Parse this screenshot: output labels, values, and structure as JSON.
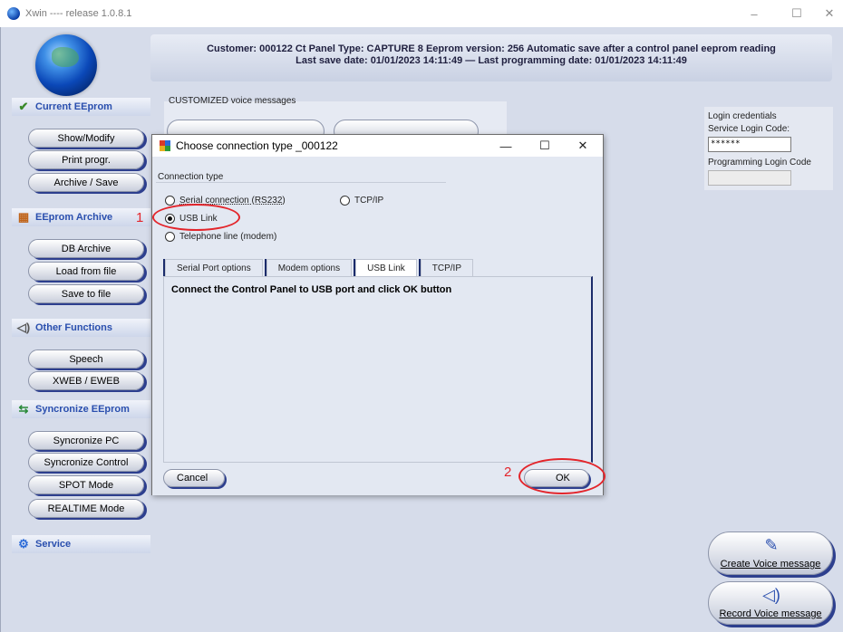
{
  "window": {
    "title": "Xwin ---- release 1.0.8.1",
    "minimize": "–",
    "maximize": "☐",
    "close": "✕"
  },
  "header": {
    "line1": "Customer: 000122 Ct Panel Type: CAPTURE 8 Eeprom version: 256  Automatic save after a control panel eeprom reading",
    "line2": "Last save date: 01/01/2023 14:11:49  —  Last programming date: 01/01/2023 14:11:49"
  },
  "sidebar": {
    "sections": [
      {
        "label": "Current EEprom",
        "icon": "check-icon",
        "glyph": "✔"
      },
      {
        "label": "EEprom Archive",
        "icon": "archive-icon",
        "glyph": "▦"
      },
      {
        "label": "Other Functions",
        "icon": "speaker-icon",
        "glyph": "🔈"
      },
      {
        "label": "Syncronize EEprom",
        "icon": "usb-icon",
        "glyph": "⇆"
      },
      {
        "label": "Service",
        "icon": "gears-icon",
        "glyph": "⚙"
      }
    ],
    "buttons": {
      "show_modify": "Show/Modify",
      "print_progr": "Print progr.",
      "archive_save": "Archive / Save",
      "db_archive": "DB Archive",
      "load_from_file": "Load from file",
      "save_to_file": "Save to file",
      "speech": "Speech",
      "xweb_eweb": "XWEB / EWEB",
      "syncronize_pc": "Syncronize PC",
      "syncronize_control": "Syncronize Control",
      "spot_mode": "SPOT Mode",
      "realtime_mode": "REALTIME Mode"
    }
  },
  "customized": {
    "label": "CUSTOMIZED voice messages"
  },
  "login": {
    "title": "Login credentials",
    "service_label": "Service Login Code:",
    "service_value": "******",
    "programming_label": "Programming Login Code",
    "programming_value": ""
  },
  "right_buttons": {
    "create_voice": "Create Voice message",
    "record_voice": "Record Voice message"
  },
  "dialog": {
    "title": "Choose connection type  _000122",
    "minimize": "—",
    "maximize": "☐",
    "close": "✕",
    "group_label": "Connection type",
    "options": {
      "serial": "Serial connection (RS232)",
      "tcpip": "TCP/IP",
      "usb": "USB Link",
      "telephone": "Telephone line (modem)"
    },
    "selected": "usb",
    "tabs": [
      "Serial Port options",
      "Modem options",
      "USB Link",
      "TCP/IP"
    ],
    "active_tab": 2,
    "message": "Connect the Control Panel to USB port and click OK button",
    "cancel": "Cancel",
    "ok": "OK"
  },
  "annotations": {
    "step1": "1",
    "step2": "2",
    "color": "#e3252b"
  },
  "colors": {
    "accent_blue": "#2a4fae",
    "background": "#d6dcea",
    "button_shadow": "#2d3f8e"
  }
}
